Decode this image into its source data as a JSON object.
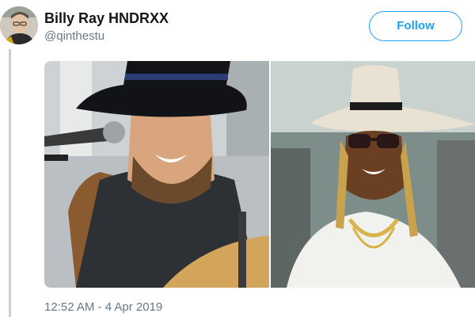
{
  "user": {
    "display_name": "Billy Ray HNDRXX",
    "handle": "@qinthestu"
  },
  "follow_label": "Follow",
  "timestamp": "12:52 AM - 4 Apr 2019",
  "media": {
    "photos": [
      {
        "icon": "photo-man-black-hat-microphone"
      },
      {
        "icon": "photo-man-white-hat-gold-chains"
      }
    ]
  },
  "colors": {
    "accent": "#1da1f2",
    "secondary_text": "#657786",
    "thread_line": "#c4cfd6"
  }
}
